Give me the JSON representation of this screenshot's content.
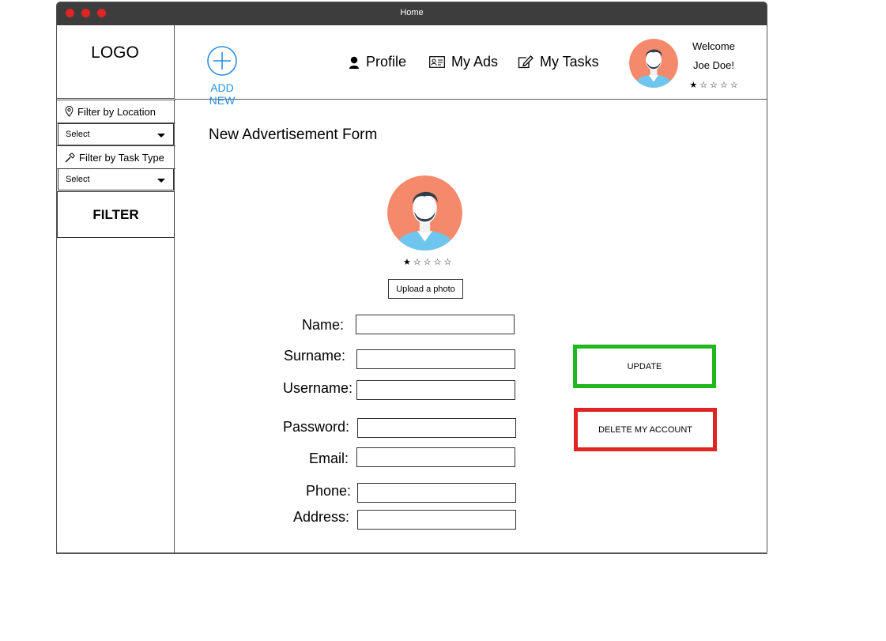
{
  "window": {
    "title": "Home"
  },
  "logo": {
    "text": "LOGO"
  },
  "sidebar": {
    "filter_location_label": "Filter by Location",
    "location_select": "Select",
    "filter_task_label": "Filter by Task Type",
    "task_select": "Select",
    "filter_button": "FILTER"
  },
  "header": {
    "add_new_label": "ADD NEW",
    "nav": [
      {
        "label": "Profile",
        "icon": "user-icon"
      },
      {
        "label": "My Ads",
        "icon": "id-card-icon"
      },
      {
        "label": "My Tasks",
        "icon": "edit-icon"
      }
    ],
    "welcome": "Welcome",
    "user_name": "Joe Doe!",
    "rating": 1,
    "rating_max": 5
  },
  "form": {
    "title": "New Advertisement Form",
    "rating": 1,
    "rating_max": 5,
    "upload_label": "Upload a photo",
    "fields": [
      {
        "label": "Name:",
        "value": ""
      },
      {
        "label": "Surname:",
        "value": ""
      },
      {
        "label": "Username:",
        "value": ""
      },
      {
        "label": "Password:",
        "value": ""
      },
      {
        "label": "Email:",
        "value": ""
      },
      {
        "label": "Phone:",
        "value": ""
      },
      {
        "label": "Address:",
        "value": ""
      }
    ],
    "update_label": "UPDATE",
    "delete_label": "DELETE MY ACCOUNT"
  },
  "colors": {
    "accent": "#2a8ee0",
    "update_border": "#1fb81f",
    "delete_border": "#e02323",
    "avatar_bg": "#f48a6b",
    "titlebar": "#3d3d3d"
  }
}
